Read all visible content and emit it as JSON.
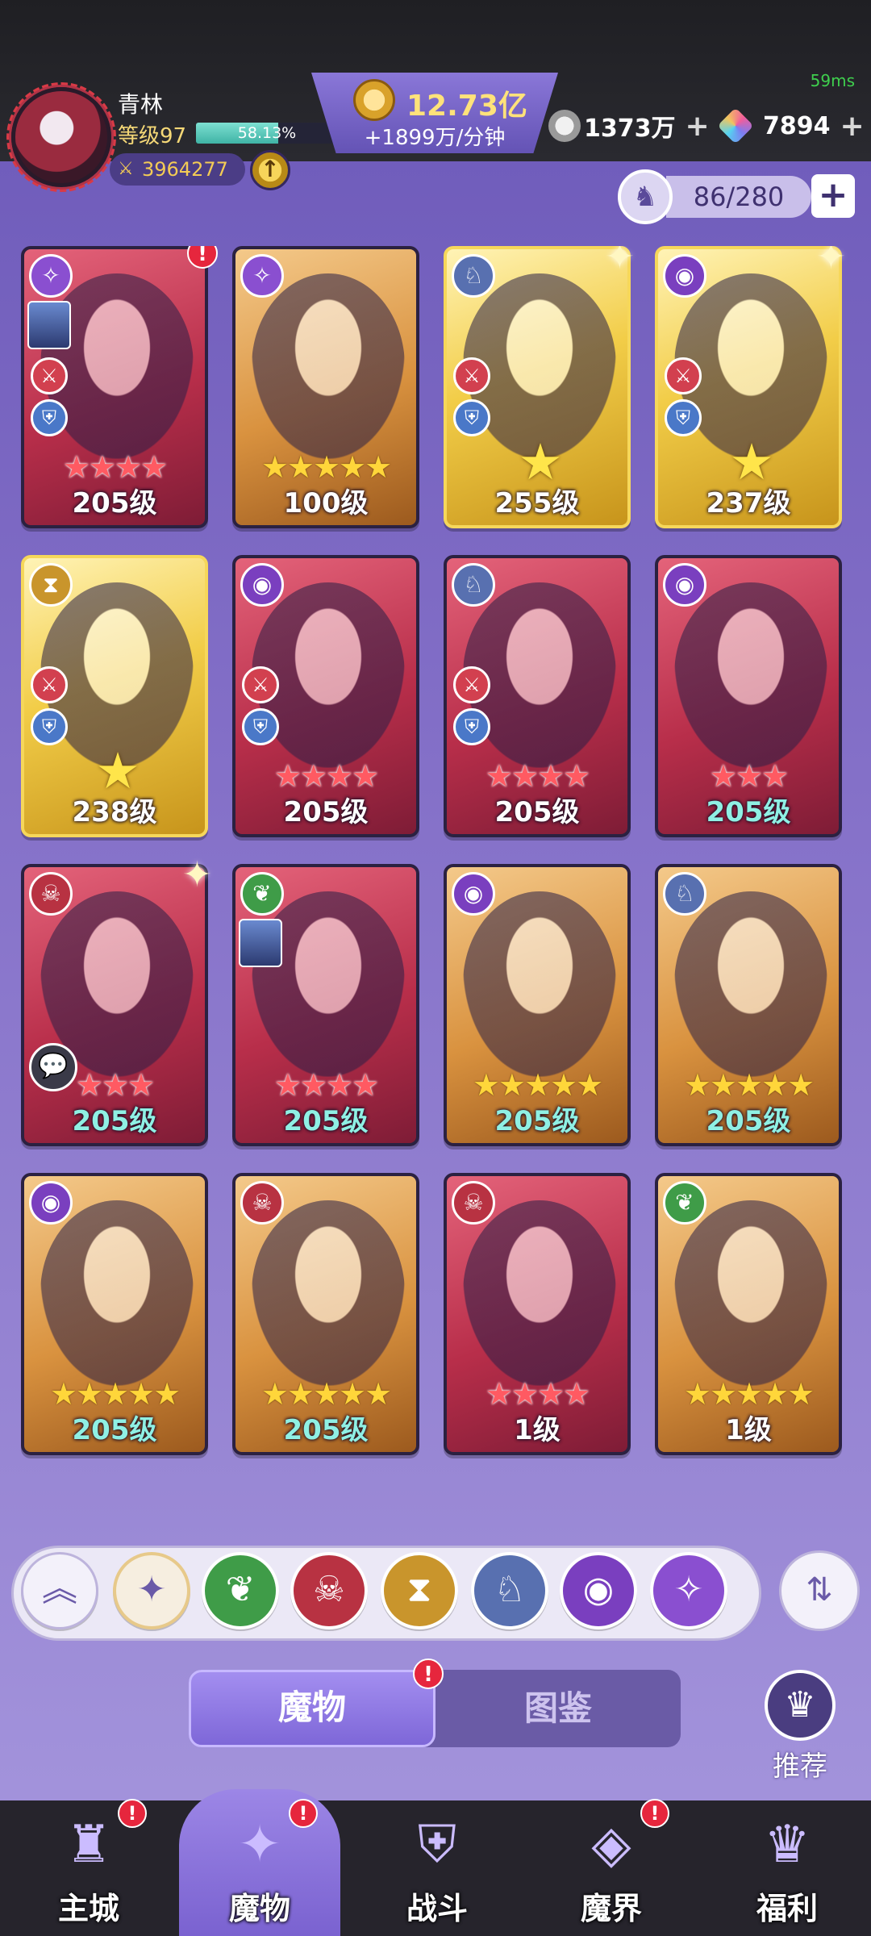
{
  "status": {
    "ping": "59ms"
  },
  "player": {
    "name": "青林",
    "level_label": "等级97",
    "xp_percent_text": "58.13%",
    "xp_fraction": 0.5813,
    "power": "3964277"
  },
  "currency": {
    "gold_amount": "12.73亿",
    "gold_rate": "+1899万/分钟",
    "silver": "1373万",
    "gems": "7894",
    "plus_symbol": "+"
  },
  "capacity": {
    "value": "86/280",
    "add_symbol": "+"
  },
  "heroes": [
    {
      "level": "205级",
      "stars": "★★★★",
      "star_type": "red",
      "frame": "red",
      "faction": "spiral",
      "alert": true,
      "mini_thumb": true
    },
    {
      "level": "100级",
      "stars": "★★★★★",
      "star_type": "gold",
      "frame": "orange",
      "faction": "spiral"
    },
    {
      "level": "255级",
      "stars": "★",
      "star_type": "big",
      "frame": "gold",
      "faction": "wolf",
      "sparkle": true
    },
    {
      "level": "237级",
      "stars": "★",
      "star_type": "big",
      "frame": "gold",
      "faction": "eye",
      "sparkle": true
    },
    {
      "level": "238级",
      "stars": "★",
      "star_type": "big",
      "frame": "gold",
      "faction": "hourglass"
    },
    {
      "level": "205级",
      "stars": "★★★★",
      "star_type": "red",
      "frame": "red",
      "faction": "eye"
    },
    {
      "level": "205级",
      "stars": "★★★★",
      "star_type": "red",
      "frame": "red",
      "faction": "wolf"
    },
    {
      "level": "205级",
      "stars": "★★★",
      "star_type": "red",
      "frame": "red",
      "faction": "eye",
      "teal": true
    },
    {
      "level": "205级",
      "stars": "★★★",
      "star_type": "red",
      "frame": "red",
      "faction": "demon",
      "teal": true,
      "sparkle": true,
      "chat": true
    },
    {
      "level": "205级",
      "stars": "★★★★",
      "star_type": "red",
      "frame": "red",
      "faction": "leaf",
      "teal": true,
      "mini_thumb": true
    },
    {
      "level": "205级",
      "stars": "★★★★★",
      "star_type": "gold",
      "frame": "orange",
      "faction": "eye",
      "teal": true
    },
    {
      "level": "205级",
      "stars": "★★★★★",
      "star_type": "gold",
      "frame": "orange",
      "faction": "wolf",
      "teal": true
    },
    {
      "level": "205级",
      "stars": "★★★★★",
      "star_type": "gold",
      "frame": "orange",
      "faction": "eye",
      "teal": true
    },
    {
      "level": "205级",
      "stars": "★★★★★",
      "star_type": "gold",
      "frame": "orange",
      "faction": "demon",
      "teal": true
    },
    {
      "level": "1级",
      "stars": "★★★★",
      "star_type": "red",
      "frame": "red",
      "faction": "demon"
    },
    {
      "level": "1级",
      "stars": "★★★★★",
      "star_type": "gold",
      "frame": "orange",
      "faction": "leaf"
    }
  ],
  "filters": [
    "collapse-icon",
    "all-icon",
    "leaf-icon",
    "demon-icon",
    "hourglass-icon",
    "wolf-icon",
    "eye-icon",
    "spiral-icon"
  ],
  "tabs": {
    "monsters": "魔物",
    "codex": "图鉴"
  },
  "recommend": {
    "label": "推荐"
  },
  "nav": [
    {
      "label": "主城",
      "icon": "castle-icon",
      "alert": true
    },
    {
      "label": "魔物",
      "icon": "flame-star-icon",
      "alert": true,
      "active": true
    },
    {
      "label": "战斗",
      "icon": "shield-sword-icon"
    },
    {
      "label": "魔界",
      "icon": "portal-icon",
      "alert": true
    },
    {
      "label": "福利",
      "icon": "chest-icon"
    }
  ],
  "alert_symbol": "!"
}
